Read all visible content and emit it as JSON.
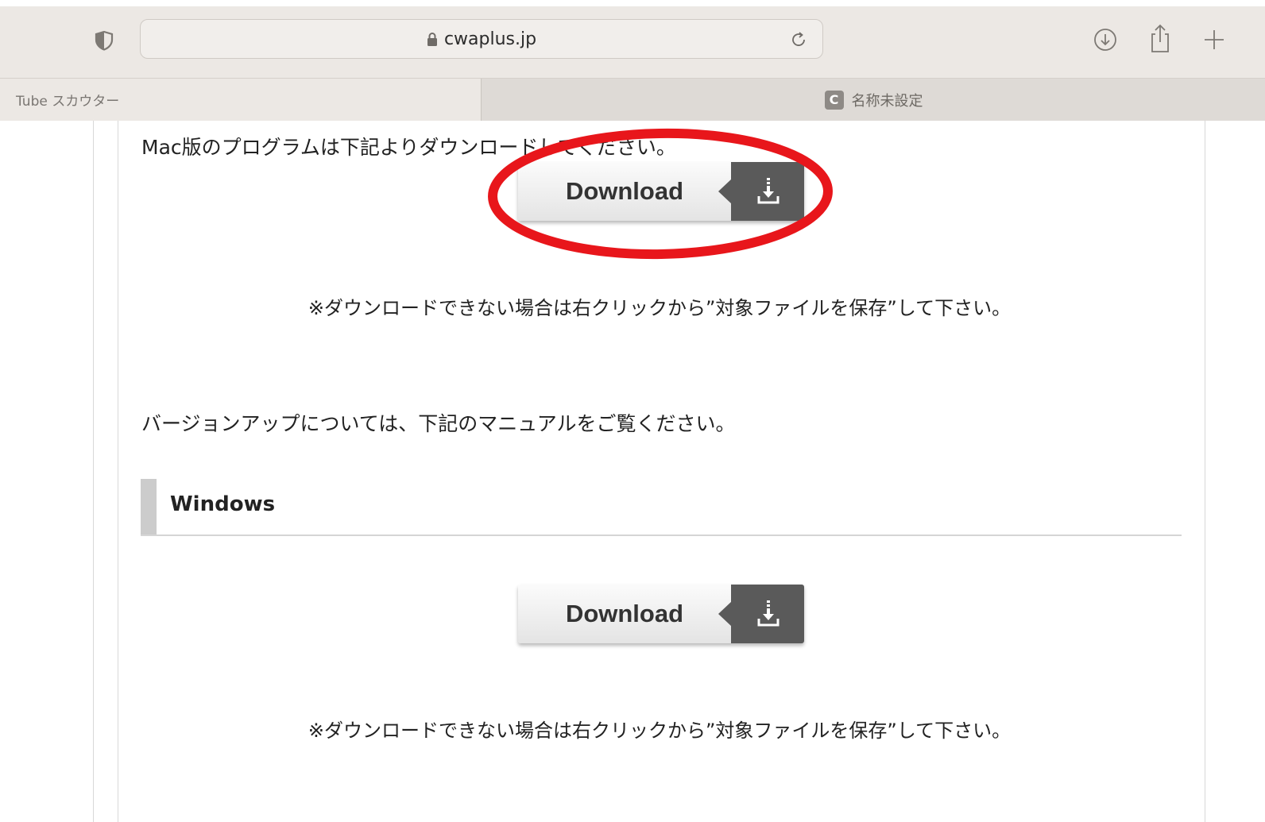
{
  "browser": {
    "url": "cwaplus.jp",
    "tabs": [
      {
        "label": "Tube スカウター",
        "active": false
      },
      {
        "label": "名称未設定",
        "favicon_letter": "C",
        "active": true
      }
    ],
    "icons": [
      "privacy-shield-icon",
      "lock-icon",
      "reload-icon",
      "downloads-icon",
      "share-icon",
      "new-tab-icon"
    ]
  },
  "page": {
    "mac_intro": "Mac版のプログラムは下記よりダウンロードしてください。",
    "download_label": "Download",
    "note": "※ダウンロードできない場合は右クリックから”対象ファイルを保存”して下さい。",
    "version_text": "バージョンアップについては、下記のマニュアルをご覧ください。",
    "windows_heading": "Windows"
  },
  "colors": {
    "annotation_circle": "#e8161b",
    "button_dark": "#5a5a5a",
    "heading_bar": "#cccccc",
    "chrome": "#ece8e4"
  }
}
